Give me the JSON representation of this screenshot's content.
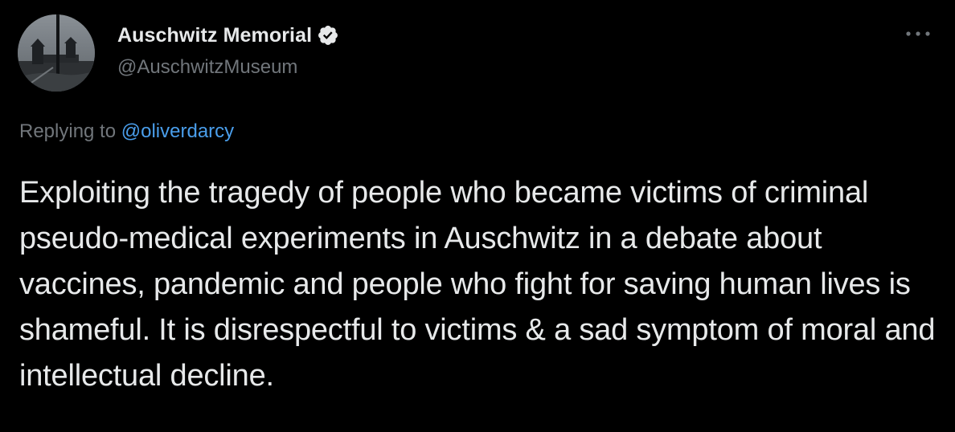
{
  "tweet": {
    "author": {
      "name": "Auschwitz Memorial",
      "handle": "@AuschwitzMuseum",
      "verified": true,
      "avatar_icon": "memorial-gate-avatar"
    },
    "more_icon": "more-options-icon",
    "reply": {
      "prefix": "Replying to",
      "mention": "@oliverdarcy"
    },
    "text": "Exploiting the tragedy of people who became victims of criminal pseudo-medical experiments in Auschwitz in a debate about vaccines, pandemic and people who fight for saving human lives is shameful. It is disrespectful to victims & a sad symptom of moral and intellectual decline."
  },
  "colors": {
    "background": "#000000",
    "primary_text": "#e7e9ea",
    "secondary_text": "#71767b",
    "link": "#4a9eeb",
    "verified_badge": "#e7e9ea"
  }
}
